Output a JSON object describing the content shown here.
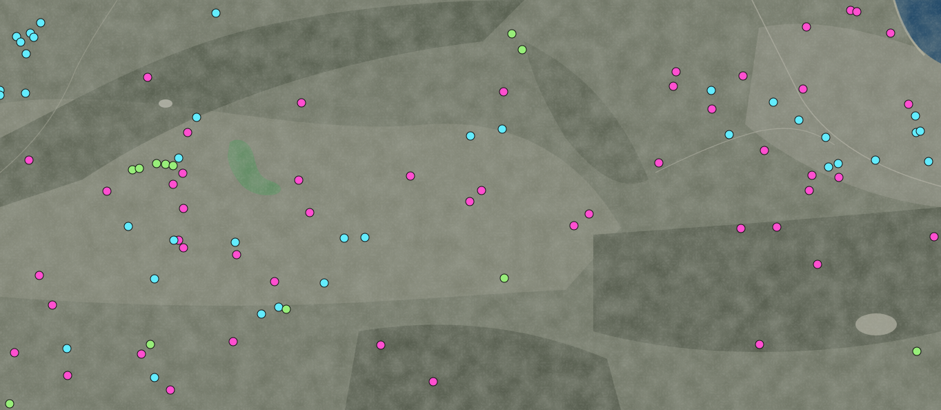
{
  "map": {
    "basemap": "satellite-imagery",
    "marker_colors": {
      "pink": "#ff4fd0",
      "cyan": "#63ecff",
      "green": "#98ee7a"
    },
    "water_color": "#5d8a60",
    "sea_color": "#123e63",
    "marker_count": 116
  }
}
